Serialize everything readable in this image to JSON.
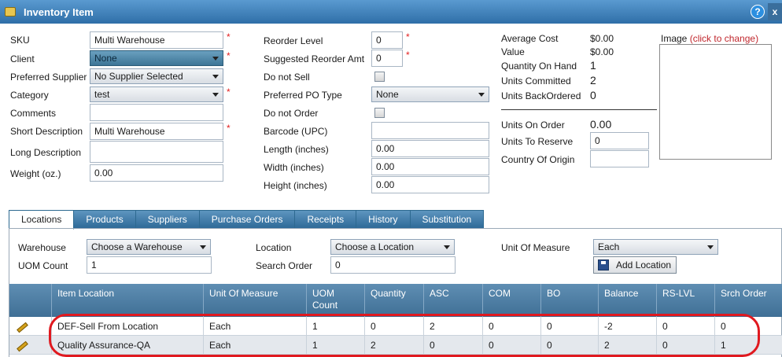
{
  "window": {
    "title": "Inventory Item",
    "help_label": "?",
    "close_label": "x"
  },
  "form_left": {
    "sku_label": "SKU",
    "sku_value": "Multi Warehouse",
    "client_label": "Client",
    "client_value": "None",
    "supplier_label": "Preferred Supplier",
    "supplier_value": "No Supplier Selected",
    "category_label": "Category",
    "category_value": "test",
    "comments_label": "Comments",
    "comments_value": "",
    "short_desc_label": "Short Description",
    "short_desc_value": "Multi Warehouse",
    "long_desc_label": "Long Description",
    "long_desc_value": "",
    "weight_label": "Weight (oz.)",
    "weight_value": "0.00"
  },
  "form_mid": {
    "reorder_level_label": "Reorder Level",
    "reorder_level_value": "0",
    "suggested_label": "Suggested Reorder Amt",
    "suggested_value": "0",
    "do_not_sell_label": "Do not Sell",
    "preferred_po_label": "Preferred PO Type",
    "preferred_po_value": "None",
    "do_not_order_label": "Do not Order",
    "barcode_label": "Barcode (UPC)",
    "barcode_value": "",
    "length_label": "Length (inches)",
    "length_value": "0.00",
    "width_label": "Width (inches)",
    "width_value": "0.00",
    "height_label": "Height (inches)",
    "height_value": "0.00"
  },
  "form_right": {
    "avg_cost_label": "Average Cost",
    "avg_cost_value": "$0.00",
    "value_label": "Value",
    "value_value": "$0.00",
    "qty_on_hand_label": "Quantity On Hand",
    "qty_on_hand_value": "1",
    "units_committed_label": "Units Committed",
    "units_committed_value": "2",
    "units_backordered_label": "Units BackOrdered",
    "units_backordered_value": "0",
    "units_on_order_label": "Units On Order",
    "units_on_order_value": "0.00",
    "units_reserve_label": "Units To Reserve",
    "units_reserve_value": "0",
    "country_label": "Country Of Origin",
    "country_value": "",
    "image_label": "Image",
    "image_link": "(click to change)"
  },
  "required_mark": "*",
  "tabs": [
    "Locations",
    "Products",
    "Suppliers",
    "Purchase Orders",
    "Receipts",
    "History",
    "Substitution"
  ],
  "locations": {
    "warehouse_label": "Warehouse",
    "warehouse_value": "Choose a Warehouse",
    "location_label": "Location",
    "location_value": "Choose a Location",
    "uom_label": "Unit Of Measure",
    "uom_value": "Each",
    "uom_count_label": "UOM Count",
    "uom_count_value": "1",
    "search_order_label": "Search Order",
    "search_order_value": "0",
    "add_location_label": "Add Location"
  },
  "grid": {
    "headers": [
      "",
      "Item Location",
      "Unit Of Measure",
      "UOM Count",
      "Quantity",
      "ASC",
      "COM",
      "BO",
      "Balance",
      "RS-LVL",
      "Srch Order"
    ],
    "rows": [
      [
        "",
        "DEF-Sell From Location",
        "Each",
        "1",
        "0",
        "2",
        "0",
        "0",
        "-2",
        "0",
        "0"
      ],
      [
        "",
        "Quality Assurance-QA",
        "Each",
        "1",
        "2",
        "0",
        "0",
        "0",
        "2",
        "0",
        "1"
      ]
    ]
  },
  "colors": {
    "title_bar": "#3f7fb8",
    "grid_header": "#4f7fa5",
    "highlight": "#e0191f",
    "required": "#e21f1f",
    "image_link": "#c0272d"
  }
}
